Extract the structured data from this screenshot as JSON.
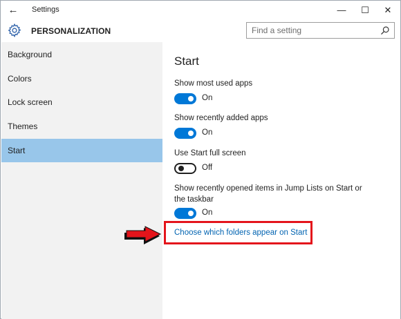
{
  "window": {
    "title": "Settings",
    "back_glyph": "←",
    "minimize_glyph": "—",
    "maximize_glyph": "☐",
    "close_glyph": "✕"
  },
  "header": {
    "title": "PERSONALIZATION",
    "icon": "gear-icon",
    "search": {
      "placeholder": "Find a setting",
      "value": ""
    }
  },
  "sidebar": {
    "items": [
      {
        "label": "Background",
        "selected": false
      },
      {
        "label": "Colors",
        "selected": false
      },
      {
        "label": "Lock screen",
        "selected": false
      },
      {
        "label": "Themes",
        "selected": false
      },
      {
        "label": "Start",
        "selected": true
      }
    ]
  },
  "main": {
    "title": "Start",
    "settings": [
      {
        "label": "Show most used apps",
        "state": "On",
        "on": true
      },
      {
        "label": "Show recently added apps",
        "state": "On",
        "on": true
      },
      {
        "label": "Use Start full screen",
        "state": "Off",
        "on": false
      },
      {
        "label": "Show recently opened items in Jump Lists on Start or the taskbar",
        "state": "On",
        "on": true
      }
    ],
    "link": "Choose which folders appear on Start"
  },
  "colors": {
    "accent": "#0078d7",
    "selection": "#98c6ea",
    "link": "#0063b1",
    "highlight_annotation": "#e4141b"
  }
}
